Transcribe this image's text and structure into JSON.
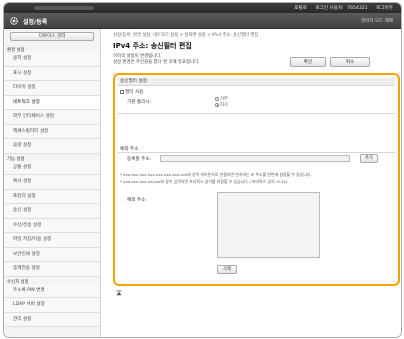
{
  "top_bar": {
    "link1": "포털로",
    "link2": "로그인 사용자:",
    "user_value": "7654321",
    "logout": "로그아웃"
  },
  "header": {
    "title": "설정/등록",
    "admin_mode": "관리자 모드 해제"
  },
  "sidebar": {
    "device_manage_button": "디바이스 관리",
    "items": [
      {
        "type": "section",
        "label": "환경 설정"
      },
      {
        "type": "item",
        "label": "용지 설정"
      },
      {
        "type": "item",
        "label": "표시 설정"
      },
      {
        "type": "item",
        "label": "타이머 설정"
      },
      {
        "type": "item",
        "label": "네트워크 설정",
        "active": true
      },
      {
        "type": "item",
        "label": "외부 인터페이스 설정"
      },
      {
        "type": "item",
        "label": "액세스빌리티 설정"
      },
      {
        "type": "item",
        "label": "음량 설정"
      },
      {
        "type": "section",
        "label": "기능 설정"
      },
      {
        "type": "item",
        "label": "공통 설정"
      },
      {
        "type": "item",
        "label": "복사 설정"
      },
      {
        "type": "item",
        "label": "프린터 설정"
      },
      {
        "type": "item",
        "label": "송신 설정"
      },
      {
        "type": "item",
        "label": "수신/전송 설정"
      },
      {
        "type": "item",
        "label": "파일 저장/이용 설정"
      },
      {
        "type": "item",
        "label": "보안인쇄 설정"
      },
      {
        "type": "item",
        "label": "중계전송 설정"
      },
      {
        "type": "section",
        "label": "수신처 설정"
      },
      {
        "type": "item",
        "label": "주소록 PIN 변경"
      },
      {
        "type": "item",
        "label": "LDAP 서버 설정"
      },
      {
        "type": "item",
        "label": "관리 설정"
      }
    ]
  },
  "main": {
    "breadcrumb": "설정/등록: 환경 설정: 네트워크 설정 > 방화벽 설정 > IPv4 주소: 송신필터 편집",
    "title": "IPv4 주소: 송신필터 편집",
    "info_line1": "이하의 설정이 변경됩니다.",
    "info_line2": "설정 변경은 주전원을 껐다 켠 후에 유효합니다.",
    "ok_label": "확인",
    "cancel_label": "취소",
    "filter_section_title": "송신필터 설정",
    "use_filter_label": "필터 사용",
    "default_policy_label": "기본 폴리시:",
    "policy_options": [
      "거부",
      "허가"
    ],
    "policy_selected": "허가",
    "exception_section_title": "예외 주소",
    "register_addr_label": "등록할 주소:",
    "address_value": "",
    "add_label": "추가",
    "note1": "* xxx.xxx.xxx.xxx-xxx.xxx.xxx.xxx와 같이 하이픈으로 연결하면 연속하는 IP 주소를 한번에 설정할 수 있습니다.",
    "note2": "* xxx.xxx.xxx.xxx/xx와 같이 입력하면 프리픽스 길이를 지정할 수 있습니다. (프리픽스 길이: 0-32)",
    "exception_addr_label": "예외 주소:",
    "delete_label": "삭제"
  }
}
